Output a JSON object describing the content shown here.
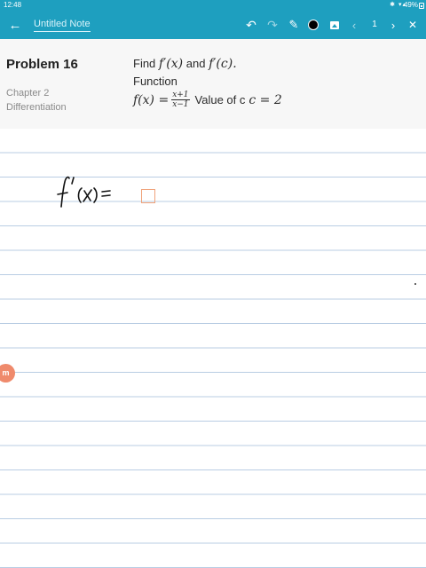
{
  "status_bar": {
    "time": "12:48",
    "battery": "49%"
  },
  "toolbar": {
    "note_title": "Untitled Note",
    "page_number": "1",
    "pen_color": "#000000",
    "accent_color": "#1e9fbf",
    "icons": [
      "back-arrow-icon",
      "undo-icon",
      "redo-icon",
      "pen-icon",
      "image-icon",
      "chevron-left-icon",
      "chevron-right-icon",
      "close-icon"
    ]
  },
  "problem": {
    "title": "Problem 16",
    "chapter": "Chapter 2",
    "topic": "Differentiation",
    "instruction_prefix": "Find",
    "derivative_x": "f′(x)",
    "and_word": "and",
    "derivative_c": "f′(c).",
    "function_label": "Function",
    "function_lhs": "f(x) =",
    "numerator": "x+1",
    "denominator": "x−1",
    "value_label": "Value of c",
    "c_value": "c = 2"
  },
  "canvas": {
    "handwritten_text": "f'(x) =",
    "line_color": "#b9cde3",
    "answer_box_color": "#f0a37b"
  },
  "side_badge": {
    "label": "m",
    "color": "#ef8a6c"
  }
}
